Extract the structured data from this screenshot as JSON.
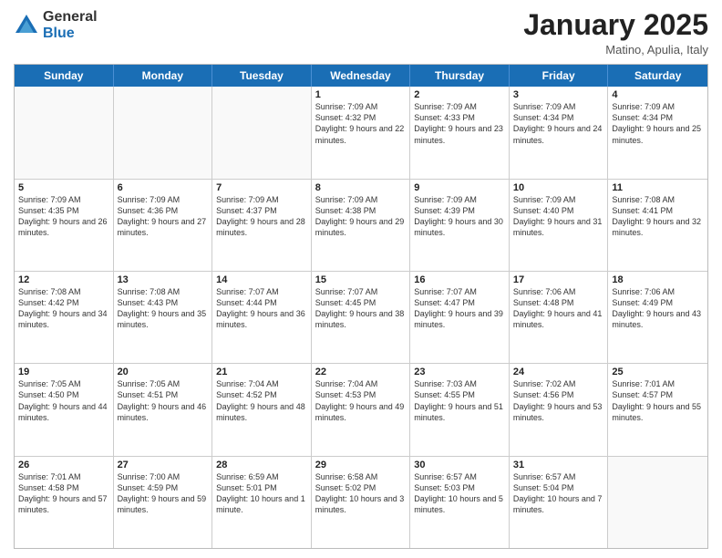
{
  "logo": {
    "general": "General",
    "blue": "Blue"
  },
  "header": {
    "month": "January 2025",
    "location": "Matino, Apulia, Italy"
  },
  "weekdays": [
    "Sunday",
    "Monday",
    "Tuesday",
    "Wednesday",
    "Thursday",
    "Friday",
    "Saturday"
  ],
  "rows": [
    [
      {
        "day": "",
        "text": "",
        "empty": true
      },
      {
        "day": "",
        "text": "",
        "empty": true
      },
      {
        "day": "",
        "text": "",
        "empty": true
      },
      {
        "day": "1",
        "text": "Sunrise: 7:09 AM\nSunset: 4:32 PM\nDaylight: 9 hours and 22 minutes."
      },
      {
        "day": "2",
        "text": "Sunrise: 7:09 AM\nSunset: 4:33 PM\nDaylight: 9 hours and 23 minutes."
      },
      {
        "day": "3",
        "text": "Sunrise: 7:09 AM\nSunset: 4:34 PM\nDaylight: 9 hours and 24 minutes."
      },
      {
        "day": "4",
        "text": "Sunrise: 7:09 AM\nSunset: 4:34 PM\nDaylight: 9 hours and 25 minutes."
      }
    ],
    [
      {
        "day": "5",
        "text": "Sunrise: 7:09 AM\nSunset: 4:35 PM\nDaylight: 9 hours and 26 minutes."
      },
      {
        "day": "6",
        "text": "Sunrise: 7:09 AM\nSunset: 4:36 PM\nDaylight: 9 hours and 27 minutes."
      },
      {
        "day": "7",
        "text": "Sunrise: 7:09 AM\nSunset: 4:37 PM\nDaylight: 9 hours and 28 minutes."
      },
      {
        "day": "8",
        "text": "Sunrise: 7:09 AM\nSunset: 4:38 PM\nDaylight: 9 hours and 29 minutes."
      },
      {
        "day": "9",
        "text": "Sunrise: 7:09 AM\nSunset: 4:39 PM\nDaylight: 9 hours and 30 minutes."
      },
      {
        "day": "10",
        "text": "Sunrise: 7:09 AM\nSunset: 4:40 PM\nDaylight: 9 hours and 31 minutes."
      },
      {
        "day": "11",
        "text": "Sunrise: 7:08 AM\nSunset: 4:41 PM\nDaylight: 9 hours and 32 minutes."
      }
    ],
    [
      {
        "day": "12",
        "text": "Sunrise: 7:08 AM\nSunset: 4:42 PM\nDaylight: 9 hours and 34 minutes."
      },
      {
        "day": "13",
        "text": "Sunrise: 7:08 AM\nSunset: 4:43 PM\nDaylight: 9 hours and 35 minutes."
      },
      {
        "day": "14",
        "text": "Sunrise: 7:07 AM\nSunset: 4:44 PM\nDaylight: 9 hours and 36 minutes."
      },
      {
        "day": "15",
        "text": "Sunrise: 7:07 AM\nSunset: 4:45 PM\nDaylight: 9 hours and 38 minutes."
      },
      {
        "day": "16",
        "text": "Sunrise: 7:07 AM\nSunset: 4:47 PM\nDaylight: 9 hours and 39 minutes."
      },
      {
        "day": "17",
        "text": "Sunrise: 7:06 AM\nSunset: 4:48 PM\nDaylight: 9 hours and 41 minutes."
      },
      {
        "day": "18",
        "text": "Sunrise: 7:06 AM\nSunset: 4:49 PM\nDaylight: 9 hours and 43 minutes."
      }
    ],
    [
      {
        "day": "19",
        "text": "Sunrise: 7:05 AM\nSunset: 4:50 PM\nDaylight: 9 hours and 44 minutes."
      },
      {
        "day": "20",
        "text": "Sunrise: 7:05 AM\nSunset: 4:51 PM\nDaylight: 9 hours and 46 minutes."
      },
      {
        "day": "21",
        "text": "Sunrise: 7:04 AM\nSunset: 4:52 PM\nDaylight: 9 hours and 48 minutes."
      },
      {
        "day": "22",
        "text": "Sunrise: 7:04 AM\nSunset: 4:53 PM\nDaylight: 9 hours and 49 minutes."
      },
      {
        "day": "23",
        "text": "Sunrise: 7:03 AM\nSunset: 4:55 PM\nDaylight: 9 hours and 51 minutes."
      },
      {
        "day": "24",
        "text": "Sunrise: 7:02 AM\nSunset: 4:56 PM\nDaylight: 9 hours and 53 minutes."
      },
      {
        "day": "25",
        "text": "Sunrise: 7:01 AM\nSunset: 4:57 PM\nDaylight: 9 hours and 55 minutes."
      }
    ],
    [
      {
        "day": "26",
        "text": "Sunrise: 7:01 AM\nSunset: 4:58 PM\nDaylight: 9 hours and 57 minutes."
      },
      {
        "day": "27",
        "text": "Sunrise: 7:00 AM\nSunset: 4:59 PM\nDaylight: 9 hours and 59 minutes."
      },
      {
        "day": "28",
        "text": "Sunrise: 6:59 AM\nSunset: 5:01 PM\nDaylight: 10 hours and 1 minute."
      },
      {
        "day": "29",
        "text": "Sunrise: 6:58 AM\nSunset: 5:02 PM\nDaylight: 10 hours and 3 minutes."
      },
      {
        "day": "30",
        "text": "Sunrise: 6:57 AM\nSunset: 5:03 PM\nDaylight: 10 hours and 5 minutes."
      },
      {
        "day": "31",
        "text": "Sunrise: 6:57 AM\nSunset: 5:04 PM\nDaylight: 10 hours and 7 minutes."
      },
      {
        "day": "",
        "text": "",
        "empty": true
      }
    ]
  ]
}
